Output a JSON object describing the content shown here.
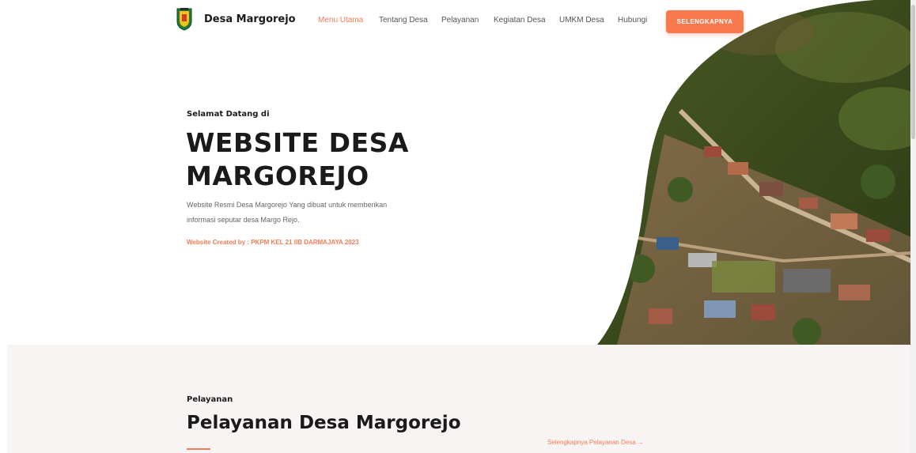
{
  "navbar": {
    "logo_icon": "village-emblem-icon",
    "brand": "Desa Margorejo",
    "items": [
      {
        "label": "Menu Utama",
        "active": true
      },
      {
        "label": "Tentang Desa",
        "active": false
      },
      {
        "label": "Pelayanan",
        "active": false
      },
      {
        "label": "Kegiatan Desa",
        "active": false
      },
      {
        "label": "UMKM Desa",
        "active": false
      },
      {
        "label": "Hubungi",
        "active": false
      }
    ],
    "cta_label": "SELENGKAPNYA"
  },
  "hero": {
    "welcome": "Selamat Datang di",
    "title_line1": "WEBSITE DESA",
    "title_line2": "MARGOREJO",
    "description_line1": "Website Resmi Desa Margorejo Yang dibuat untuk memberikan",
    "description_line2": "informasi seputar desa Margo Rejo.",
    "credit": "Website Created by : PKPM KEL 21 IIB DARMAJAYA 2023",
    "image": "aerial-village-photo"
  },
  "services": {
    "eyebrow": "Pelayanan",
    "title": "Pelayanan Desa Margorejo",
    "link_label": "Selengkapnya Pelayanan Desa",
    "link_icon": "arrow-right-icon"
  },
  "colors": {
    "accent": "#f47c55",
    "button": "#f9794f",
    "section_bg": "#f8f4f3",
    "text_dark": "#1a1a1a"
  }
}
